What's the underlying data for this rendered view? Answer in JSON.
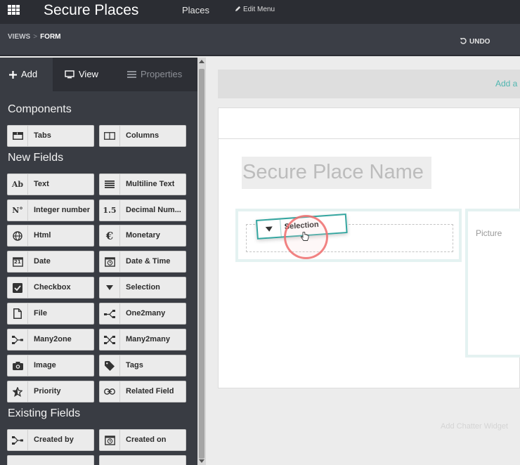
{
  "header": {
    "app_title": "Secure Places",
    "menu_places": "Places",
    "edit_menu": "Edit Menu"
  },
  "breadcrumb": {
    "views": "VIEWS",
    "separator": ">",
    "current": "FORM"
  },
  "toolbar": {
    "undo": "UNDO"
  },
  "sidebar": {
    "tabs": {
      "add": "Add",
      "view": "View",
      "properties": "Properties"
    },
    "sections": {
      "components": "Components",
      "new_fields": "New Fields",
      "existing_fields": "Existing Fields"
    },
    "components": [
      {
        "label": "Tabs",
        "icon": "tabs-icon"
      },
      {
        "label": "Columns",
        "icon": "columns-icon"
      }
    ],
    "new_fields": [
      {
        "label": "Text",
        "icon": "text-icon",
        "glyph": "Ab"
      },
      {
        "label": "Multiline Text",
        "icon": "multiline-icon",
        "glyph": "≡"
      },
      {
        "label": "Integer number",
        "icon": "integer-icon",
        "glyph": "N°"
      },
      {
        "label": "Decimal Num...",
        "icon": "decimal-icon",
        "glyph": "1.5"
      },
      {
        "label": "Html",
        "icon": "globe-icon",
        "glyph": ""
      },
      {
        "label": "Monetary",
        "icon": "euro-icon",
        "glyph": "€"
      },
      {
        "label": "Date",
        "icon": "calendar-icon",
        "glyph": "21"
      },
      {
        "label": "Date & Time",
        "icon": "calendar-clock-icon",
        "glyph": ""
      },
      {
        "label": "Checkbox",
        "icon": "checkbox-icon",
        "glyph": ""
      },
      {
        "label": "Selection",
        "icon": "caret-down-icon",
        "glyph": ""
      },
      {
        "label": "File",
        "icon": "file-icon",
        "glyph": ""
      },
      {
        "label": "One2many",
        "icon": "one2many-icon",
        "glyph": ""
      },
      {
        "label": "Many2one",
        "icon": "many2one-icon",
        "glyph": ""
      },
      {
        "label": "Many2many",
        "icon": "many2many-icon",
        "glyph": ""
      },
      {
        "label": "Image",
        "icon": "camera-icon",
        "glyph": ""
      },
      {
        "label": "Tags",
        "icon": "tag-icon",
        "glyph": ""
      },
      {
        "label": "Priority",
        "icon": "star-icon",
        "glyph": ""
      },
      {
        "label": "Related Field",
        "icon": "link-icon",
        "glyph": ""
      }
    ],
    "existing_fields": [
      {
        "label": "Created by",
        "icon": "many2one-icon"
      },
      {
        "label": "Created on",
        "icon": "calendar-clock-icon"
      }
    ]
  },
  "form": {
    "add_bar": "Add a",
    "title_placeholder": "Secure Place Name",
    "picture_label": "Picture",
    "chatter": "Add Chatter Widget",
    "dragged_field": "Selection"
  },
  "colors": {
    "navbar": "#2b2d33",
    "sidebar": "#393c43",
    "accent": "#35a6a0",
    "click_ring": "#f06e6e"
  }
}
